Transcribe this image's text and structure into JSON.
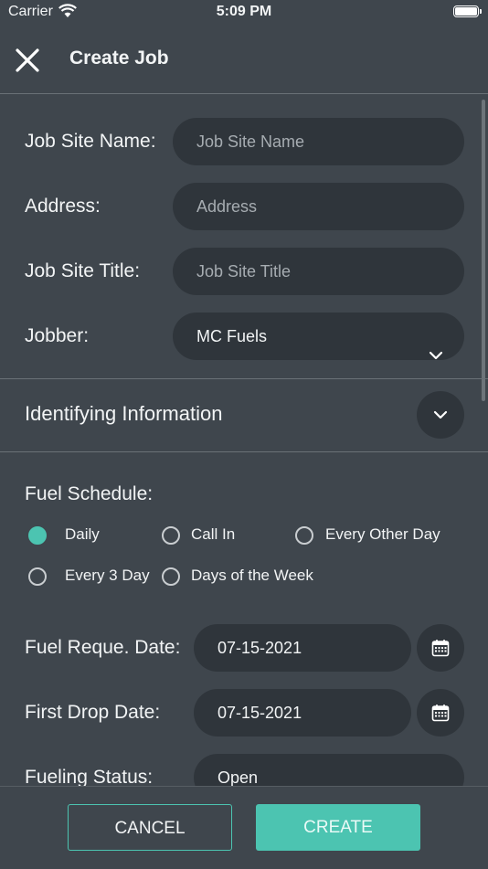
{
  "status_bar": {
    "carrier": "Carrier",
    "time": "5:09 PM"
  },
  "header": {
    "title": "Create Job",
    "close_icon": "close-icon"
  },
  "form": {
    "job_site_name": {
      "label": "Job Site Name:",
      "placeholder": "Job Site Name"
    },
    "address": {
      "label": "Address:",
      "placeholder": "Address"
    },
    "job_site_title": {
      "label": "Job Site Title:",
      "placeholder": "Job Site Title"
    },
    "jobber": {
      "label": "Jobber:",
      "value": "MC Fuels"
    }
  },
  "identifying_section": {
    "title": "Identifying Information",
    "icon": "chevron-down-icon"
  },
  "fuel_schedule": {
    "label": "Fuel Schedule:",
    "options": [
      "Daily",
      "Call In",
      "Every Other Day",
      "Every 3 Day",
      "Days of the Week"
    ],
    "selected": "Daily"
  },
  "dates": {
    "fuel_request": {
      "label": "Fuel Reque. Date:",
      "value": "07-15-2021",
      "icon": "calendar-icon"
    },
    "first_drop": {
      "label": "First Drop Date:",
      "value": "07-15-2021",
      "icon": "calendar-icon"
    }
  },
  "fueling_status": {
    "label": "Fueling Status:",
    "value": "Open"
  },
  "footer": {
    "cancel_label": "CANCEL",
    "create_label": "CREATE"
  },
  "colors": {
    "accent": "#4cc4b1",
    "background": "#3f464d",
    "field": "#2f353b"
  }
}
